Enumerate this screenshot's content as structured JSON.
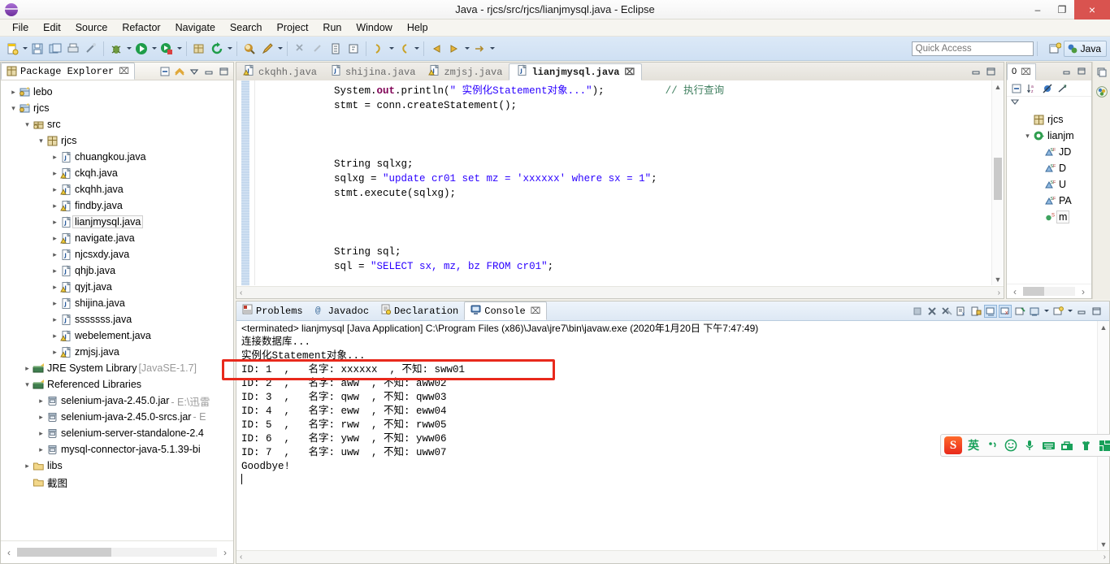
{
  "window": {
    "title": "Java - rjcs/src/rjcs/lianjmysql.java - Eclipse",
    "minimize": "–",
    "maximize": "❐",
    "close": "×",
    "logo_name": "eclipse-logo"
  },
  "menubar": [
    "File",
    "Edit",
    "Source",
    "Refactor",
    "Navigate",
    "Search",
    "Project",
    "Run",
    "Window",
    "Help"
  ],
  "toolbar": {
    "quick_access_placeholder": "Quick Access",
    "quick_access_value": "",
    "perspective_label": "Java"
  },
  "package_explorer": {
    "title": "Package Explorer",
    "close_glyph": "⌧",
    "tools": [
      "collapse-all",
      "link-with-editor",
      "view-menu",
      "minimize",
      "maximize"
    ],
    "tree": [
      {
        "depth": 0,
        "arrow": "closed",
        "icon": "java-project",
        "label": "lebo",
        "sub": ""
      },
      {
        "depth": 0,
        "arrow": "open",
        "icon": "java-project",
        "label": "rjcs",
        "sub": ""
      },
      {
        "depth": 1,
        "arrow": "open",
        "icon": "source-folder",
        "label": "src",
        "sub": ""
      },
      {
        "depth": 2,
        "arrow": "open",
        "icon": "package",
        "label": "rjcs",
        "sub": ""
      },
      {
        "depth": 3,
        "arrow": "closed",
        "icon": "java-file",
        "label": "chuangkou.java",
        "sub": ""
      },
      {
        "depth": 3,
        "arrow": "closed",
        "icon": "java-file-warn",
        "label": "ckqh.java",
        "sub": ""
      },
      {
        "depth": 3,
        "arrow": "closed",
        "icon": "java-file-warn",
        "label": "ckqhh.java",
        "sub": ""
      },
      {
        "depth": 3,
        "arrow": "closed",
        "icon": "java-file-warn",
        "label": "findby.java",
        "sub": ""
      },
      {
        "depth": 3,
        "arrow": "closed",
        "icon": "java-file",
        "label": "lianjmysql.java",
        "sub": "",
        "selected": true
      },
      {
        "depth": 3,
        "arrow": "closed",
        "icon": "java-file-warn",
        "label": "navigate.java",
        "sub": ""
      },
      {
        "depth": 3,
        "arrow": "closed",
        "icon": "java-file",
        "label": "njcsxdy.java",
        "sub": ""
      },
      {
        "depth": 3,
        "arrow": "closed",
        "icon": "java-file",
        "label": "qhjb.java",
        "sub": ""
      },
      {
        "depth": 3,
        "arrow": "closed",
        "icon": "java-file-warn",
        "label": "qyjt.java",
        "sub": ""
      },
      {
        "depth": 3,
        "arrow": "closed",
        "icon": "java-file",
        "label": "shijina.java",
        "sub": ""
      },
      {
        "depth": 3,
        "arrow": "closed",
        "icon": "java-file",
        "label": "sssssss.java",
        "sub": ""
      },
      {
        "depth": 3,
        "arrow": "closed",
        "icon": "java-file-warn",
        "label": "webelement.java",
        "sub": ""
      },
      {
        "depth": 3,
        "arrow": "closed",
        "icon": "java-file-warn",
        "label": "zmjsj.java",
        "sub": ""
      },
      {
        "depth": 1,
        "arrow": "closed",
        "icon": "library",
        "label": "JRE System Library",
        "sub": "[JavaSE-1.7]"
      },
      {
        "depth": 1,
        "arrow": "open",
        "icon": "library",
        "label": "Referenced Libraries",
        "sub": ""
      },
      {
        "depth": 2,
        "arrow": "closed",
        "icon": "jar",
        "label": "selenium-java-2.45.0.jar",
        "sub": "- E:\\迅雷"
      },
      {
        "depth": 2,
        "arrow": "closed",
        "icon": "jar",
        "label": "selenium-java-2.45.0-srcs.jar",
        "sub": "- E"
      },
      {
        "depth": 2,
        "arrow": "closed",
        "icon": "jar",
        "label": "selenium-server-standalone-2.4",
        "sub": ""
      },
      {
        "depth": 2,
        "arrow": "closed",
        "icon": "jar",
        "label": "mysql-connector-java-5.1.39-bi",
        "sub": ""
      },
      {
        "depth": 1,
        "arrow": "closed",
        "icon": "folder",
        "label": "libs",
        "sub": ""
      },
      {
        "depth": 1,
        "arrow": "none",
        "icon": "folder",
        "label": "截图",
        "sub": ""
      }
    ]
  },
  "editor": {
    "tabs": [
      {
        "label": "ckqhh.java",
        "icon": "java-file-warn",
        "active": false
      },
      {
        "label": "shijina.java",
        "icon": "java-file",
        "active": false
      },
      {
        "label": "zmjsj.java",
        "icon": "java-file-warn",
        "active": false
      },
      {
        "label": "lianjmysql.java",
        "icon": "java-file",
        "active": true,
        "close_glyph": "⌧"
      }
    ],
    "tools": [
      "minimize",
      "maximize"
    ],
    "code_lines": [
      [
        {
          "t": "            System.",
          "c": ""
        },
        {
          "t": "out",
          "c": "kw"
        },
        {
          "t": ".println(",
          "c": ""
        },
        {
          "t": "\" 实例化Statement对象...\"",
          "c": "str"
        },
        {
          "t": ");          ",
          "c": ""
        },
        {
          "t": "// 执行查询",
          "c": "cmt"
        }
      ],
      [
        {
          "t": "            stmt = conn.createStatement();",
          "c": ""
        }
      ],
      [
        {
          "t": "",
          "c": ""
        }
      ],
      [
        {
          "t": "",
          "c": ""
        }
      ],
      [
        {
          "t": "",
          "c": ""
        }
      ],
      [
        {
          "t": "            String sqlxg;",
          "c": ""
        }
      ],
      [
        {
          "t": "            sqlxg = ",
          "c": ""
        },
        {
          "t": "\"update cr01 set mz = 'xxxxxx' where sx = 1\"",
          "c": "str"
        },
        {
          "t": ";",
          "c": ""
        }
      ],
      [
        {
          "t": "            stmt.execute(sqlxg);",
          "c": ""
        }
      ],
      [
        {
          "t": "",
          "c": ""
        }
      ],
      [
        {
          "t": "",
          "c": ""
        }
      ],
      [
        {
          "t": "",
          "c": ""
        }
      ],
      [
        {
          "t": "            String sql;",
          "c": ""
        }
      ],
      [
        {
          "t": "            sql = ",
          "c": ""
        },
        {
          "t": "\"SELECT sx, mz, bz FROM cr01\"",
          "c": "str"
        },
        {
          "t": ";",
          "c": ""
        }
      ]
    ]
  },
  "outline": {
    "title": "0",
    "close_glyph": "⌧",
    "tools": [
      "collapse-all",
      "sort",
      "hide-fields",
      "hide-static",
      "view-menu"
    ],
    "tree": [
      {
        "depth": 1,
        "arrow": "none",
        "icon": "package",
        "label": "rjcs"
      },
      {
        "depth": 1,
        "arrow": "open",
        "icon": "class",
        "label": "lianjm"
      },
      {
        "depth": 2,
        "arrow": "none",
        "icon": "field-static-final",
        "label": "JD"
      },
      {
        "depth": 2,
        "arrow": "none",
        "icon": "field-static-final",
        "label": "D"
      },
      {
        "depth": 2,
        "arrow": "none",
        "icon": "field-static-final",
        "label": "U"
      },
      {
        "depth": 2,
        "arrow": "none",
        "icon": "field-static-final",
        "label": "PA"
      },
      {
        "depth": 2,
        "arrow": "none",
        "icon": "method-static",
        "label": "m",
        "selected": true
      }
    ]
  },
  "console": {
    "tabs": [
      {
        "label": "Problems",
        "icon": "problems-icon",
        "active": false
      },
      {
        "label": "Javadoc",
        "icon": "javadoc-icon",
        "active": false
      },
      {
        "label": "Declaration",
        "icon": "declaration-icon",
        "active": false
      },
      {
        "label": "Console",
        "icon": "console-icon",
        "active": true,
        "close_glyph": "⌧"
      }
    ],
    "tools": [
      "terminate-all",
      "remove-launch",
      "remove-all-terminated",
      "clear-console",
      "scroll-lock",
      "show-console-on-output",
      "pin-console",
      "display-selected-console",
      "open-console",
      "minimize",
      "maximize"
    ],
    "header": "<terminated> lianjmysql [Java Application] C:\\Program Files (x86)\\Java\\jre7\\bin\\javaw.exe (2020年1月20日 下午7:47:49)",
    "lines": [
      "连接数据库...",
      "实例化Statement对象...",
      "ID: 1  ,   名字: xxxxxx  , 不知: sww01",
      "ID: 2  ,   名字: aww  , 不知: aww02",
      "ID: 3  ,   名字: qww  , 不知: qww03",
      "ID: 4  ,   名字: eww  , 不知: eww04",
      "ID: 5  ,   名字: rww  , 不知: rww05",
      "ID: 6  ,   名字: yww  , 不知: yww06",
      "ID: 7  ,   名字: uww  , 不知: uww07",
      "Goodbye!"
    ],
    "annotation_color": "#e8291c"
  },
  "ime": {
    "logo": "S",
    "mode_label": "英",
    "icons": [
      "punctuation-icon",
      "emoji-icon",
      "voice-icon",
      "keyboard-icon",
      "toolbox-icon",
      "skin-icon",
      "apps-icon"
    ]
  }
}
